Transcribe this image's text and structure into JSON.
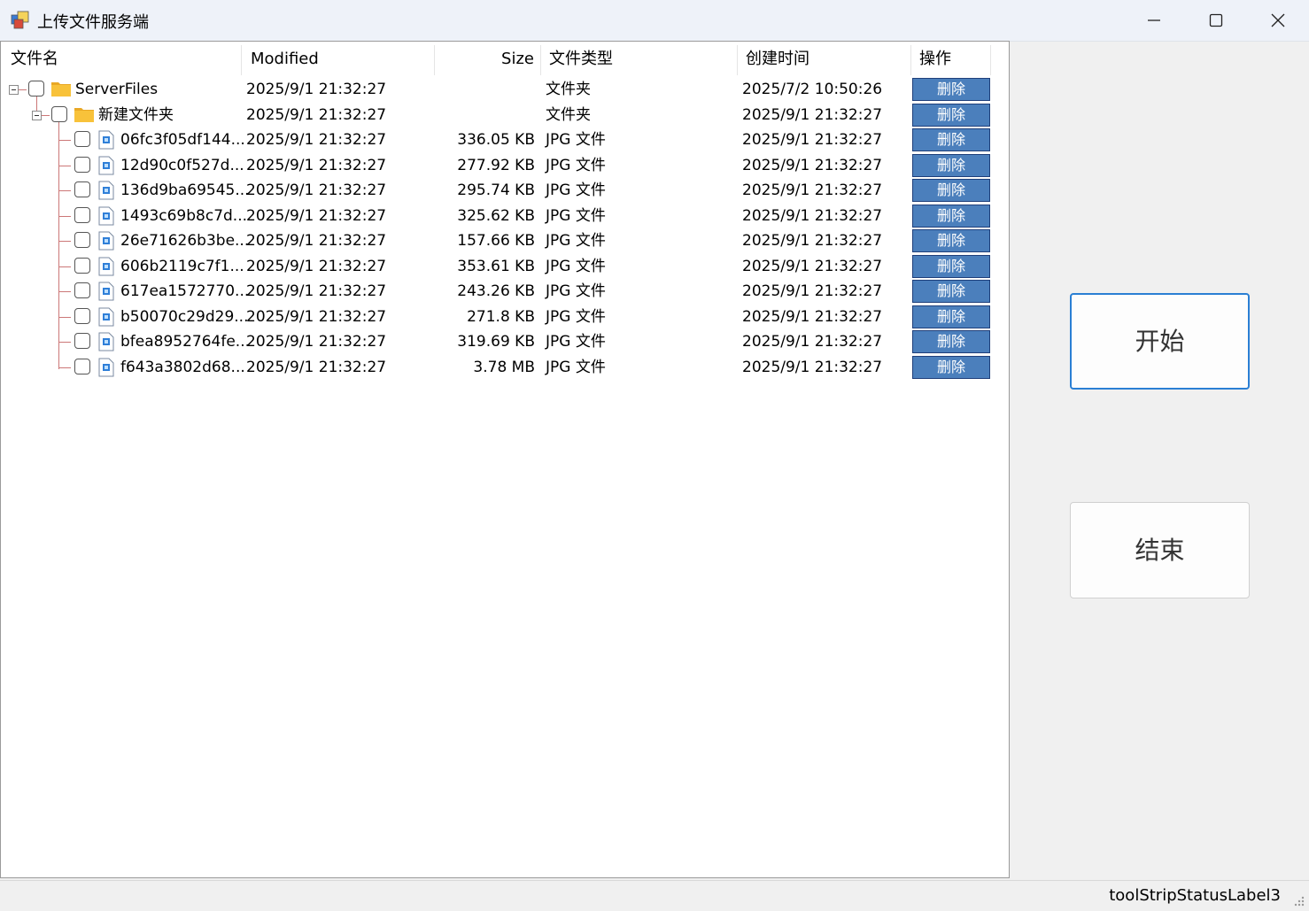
{
  "window": {
    "title": "上传文件服务端"
  },
  "columns": [
    "文件名",
    "Modified",
    "Size",
    "文件类型",
    "创建时间",
    "操作"
  ],
  "rows": [
    {
      "name": "ServerFiles",
      "modified": "2025/9/1 21:32:27",
      "size": "",
      "type": "文件夹",
      "created": "2025/7/2 10:50:26",
      "action": "删除",
      "kind": "folder",
      "level": 0
    },
    {
      "name": "新建文件夹",
      "modified": "2025/9/1 21:32:27",
      "size": "",
      "type": "文件夹",
      "created": "2025/9/1 21:32:27",
      "action": "删除",
      "kind": "folder",
      "level": 1
    },
    {
      "name": "06fc3f05df144...",
      "modified": "2025/9/1 21:32:27",
      "size": "336.05 KB",
      "type": "JPG 文件",
      "created": "2025/9/1 21:32:27",
      "action": "删除",
      "kind": "file",
      "level": 2
    },
    {
      "name": "12d90c0f527d...",
      "modified": "2025/9/1 21:32:27",
      "size": "277.92 KB",
      "type": "JPG 文件",
      "created": "2025/9/1 21:32:27",
      "action": "删除",
      "kind": "file",
      "level": 2
    },
    {
      "name": "136d9ba69545...",
      "modified": "2025/9/1 21:32:27",
      "size": "295.74 KB",
      "type": "JPG 文件",
      "created": "2025/9/1 21:32:27",
      "action": "删除",
      "kind": "file",
      "level": 2
    },
    {
      "name": "1493c69b8c7d...",
      "modified": "2025/9/1 21:32:27",
      "size": "325.62 KB",
      "type": "JPG 文件",
      "created": "2025/9/1 21:32:27",
      "action": "删除",
      "kind": "file",
      "level": 2
    },
    {
      "name": "26e71626b3be...",
      "modified": "2025/9/1 21:32:27",
      "size": "157.66 KB",
      "type": "JPG 文件",
      "created": "2025/9/1 21:32:27",
      "action": "删除",
      "kind": "file",
      "level": 2
    },
    {
      "name": "606b2119c7f1...",
      "modified": "2025/9/1 21:32:27",
      "size": "353.61 KB",
      "type": "JPG 文件",
      "created": "2025/9/1 21:32:27",
      "action": "删除",
      "kind": "file",
      "level": 2
    },
    {
      "name": "617ea1572770...",
      "modified": "2025/9/1 21:32:27",
      "size": "243.26 KB",
      "type": "JPG 文件",
      "created": "2025/9/1 21:32:27",
      "action": "删除",
      "kind": "file",
      "level": 2
    },
    {
      "name": "b50070c29d29...",
      "modified": "2025/9/1 21:32:27",
      "size": "271.8 KB",
      "type": "JPG 文件",
      "created": "2025/9/1 21:32:27",
      "action": "删除",
      "kind": "file",
      "level": 2
    },
    {
      "name": "bfea8952764fe...",
      "modified": "2025/9/1 21:32:27",
      "size": "319.69 KB",
      "type": "JPG 文件",
      "created": "2025/9/1 21:32:27",
      "action": "删除",
      "kind": "file",
      "level": 2
    },
    {
      "name": "f643a3802d68...",
      "modified": "2025/9/1 21:32:27",
      "size": "3.78 MB",
      "type": "JPG 文件",
      "created": "2025/9/1 21:32:27",
      "action": "删除",
      "kind": "file",
      "level": 2
    }
  ],
  "buttons": {
    "start": "开始",
    "stop": "结束"
  },
  "status": {
    "label": "toolStripStatusLabel3"
  },
  "colors": {
    "delete_button": "#4b7fbc",
    "folder": "#f8c23a",
    "focus_border": "#2a7fd4"
  },
  "icons": {
    "folder": "folder-icon",
    "file": "image-file-icon",
    "minimize": "minimize-icon",
    "maximize": "maximize-icon",
    "close": "close-icon"
  }
}
